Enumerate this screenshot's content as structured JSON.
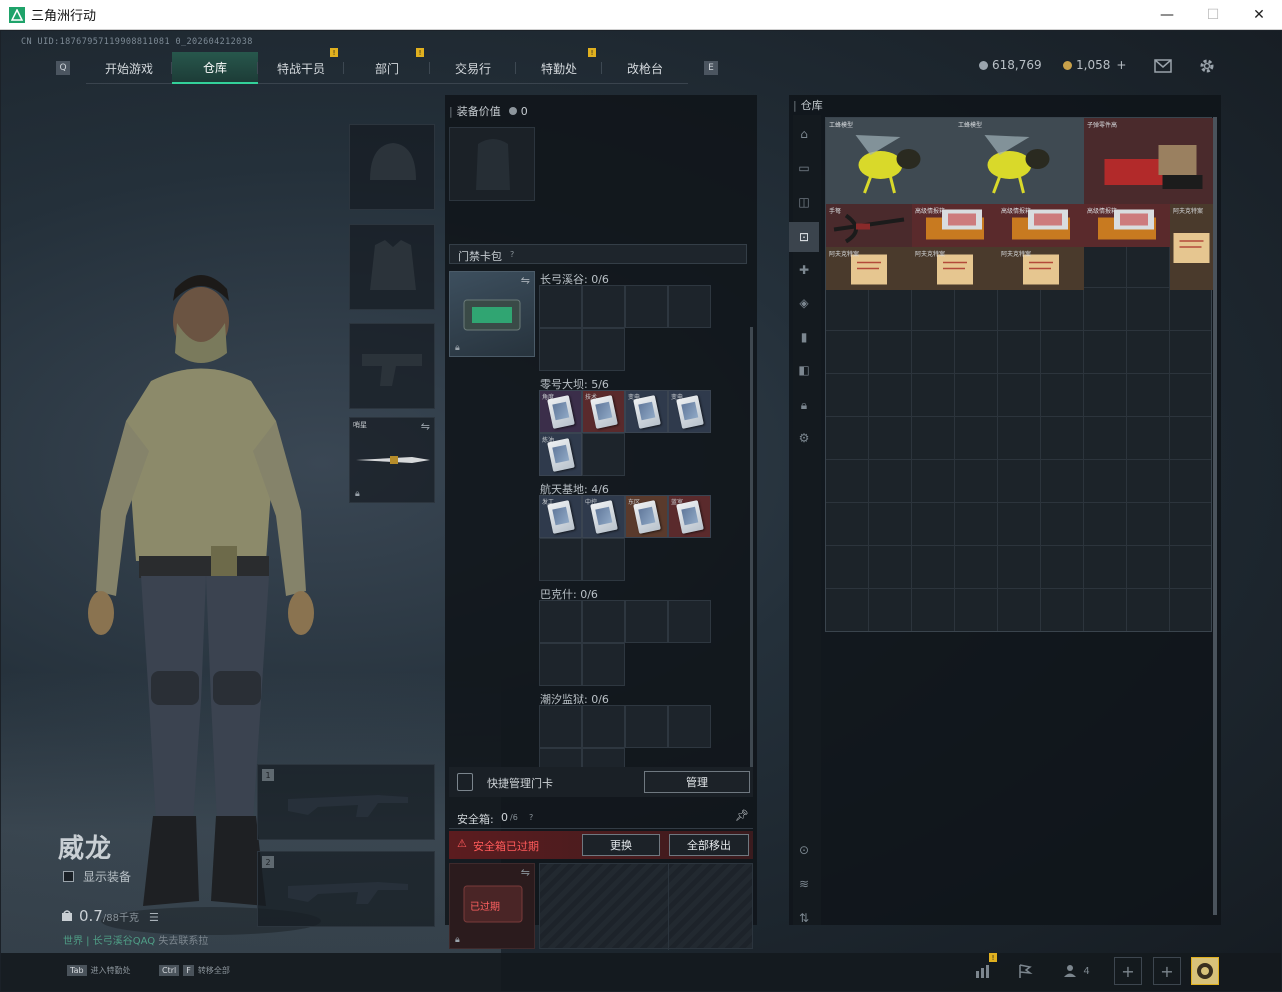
{
  "window": {
    "title": "三角洲行动",
    "minimize": "—",
    "maximize": "☐",
    "close": "✕"
  },
  "uid": "CN UID:18767957119908811081 0_202604212038",
  "nav": {
    "left_key": "Q",
    "right_key": "E",
    "tabs": [
      {
        "label": "开始游戏",
        "active": false,
        "badge": false
      },
      {
        "label": "仓库",
        "active": true,
        "badge": false
      },
      {
        "label": "特战干员",
        "active": false,
        "badge": true
      },
      {
        "label": "部门",
        "active": false,
        "badge": true
      },
      {
        "label": "交易行",
        "active": false,
        "badge": false
      },
      {
        "label": "特勤处",
        "active": false,
        "badge": true
      },
      {
        "label": "改枪台",
        "active": false,
        "badge": false
      }
    ],
    "badge_mark": "!"
  },
  "currency": {
    "silver": "618,769",
    "gold": "1,058",
    "gold_add": "+"
  },
  "icons": {
    "mail": "mail-icon",
    "settings": "gear-icon"
  },
  "character": {
    "name": "威龙",
    "show_equipment": "显示装备",
    "weight_value": "0.7",
    "weight_max": "/88千克",
    "world_status": "世界 | 长弓溪谷QAQ",
    "world_status2": "失去联系拉"
  },
  "equip_slots": {
    "melee_label": "哨星"
  },
  "weapon_slots": [
    "1",
    "2"
  ],
  "middle": {
    "equip_value_label": "装备价值",
    "equip_value": "0",
    "keycard_pack_label": "门禁卡包",
    "help": "?",
    "areas": [
      {
        "name": "长弓溪谷: 0/6"
      },
      {
        "name": "零号大坝: 5/6",
        "cards": [
          "角度",
          "技术",
          "变电",
          "变电",
          "炼油"
        ]
      },
      {
        "name": "航天基地: 4/6",
        "cards": [
          "发工",
          "中控",
          "东区",
          "蓝室"
        ]
      },
      {
        "name": "巴克什: 0/6"
      },
      {
        "name": "潮汐监狱: 0/6"
      }
    ],
    "quick_manage": "快捷管理门卡",
    "manage": "管理",
    "safebox_label": "安全箱:",
    "safebox_count": "0",
    "safebox_max": "/6",
    "safebox_expired_warning": "安全箱已过期",
    "replace": "更换",
    "move_all": "全部移出",
    "expired": "已过期"
  },
  "warehouse": {
    "title": "仓库",
    "items": [
      {
        "label": "工蜂模型",
        "kind": "bee"
      },
      {
        "label": "工蜂模型",
        "kind": "bee"
      },
      {
        "label": "子弹零件高",
        "kind": "ammo"
      },
      {
        "label": "手弩",
        "kind": "crossbow"
      },
      {
        "label": "高级情报箱",
        "kind": "case"
      },
      {
        "label": "高级情报箱",
        "kind": "case"
      },
      {
        "label": "高级情报箱",
        "kind": "case"
      },
      {
        "label": "阿夫克特案",
        "kind": "doc"
      },
      {
        "label": "阿夫克特案",
        "kind": "doc"
      },
      {
        "label": "阿夫克特案",
        "kind": "doc"
      },
      {
        "label": "阿夫克特案",
        "kind": "doc"
      }
    ]
  },
  "bottom": {
    "hint1_key": "Tab",
    "hint1": "进入特勤处",
    "hint2_key": "Ctrl",
    "hint2_key2": "F",
    "hint2": "转移全部",
    "squad_count": "4"
  }
}
